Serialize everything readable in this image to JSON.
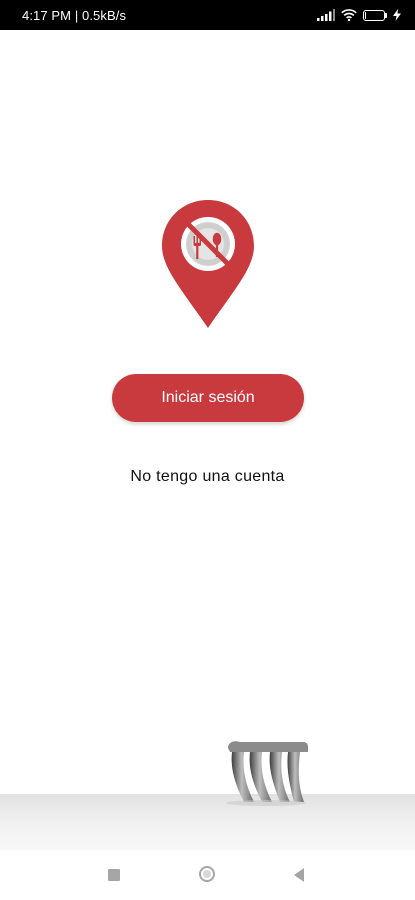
{
  "status_bar": {
    "time_speed": "4:17 PM | 0.5kB/s",
    "battery_level": "7",
    "icons": [
      "signal-icon",
      "wifi-icon",
      "battery-icon",
      "charging-icon"
    ],
    "battery_fraction": 0.07
  },
  "logo": {
    "icon": "map-pin-utensils-icon",
    "color": "#c93a3e"
  },
  "actions": {
    "login_label": "Iniciar sesión",
    "no_account_label": "No tengo una cuenta"
  },
  "colors": {
    "accent": "#c93a3e",
    "background": "#ffffff"
  },
  "nav_bar": {
    "icons": [
      "recent-apps-icon",
      "home-icon",
      "back-icon"
    ]
  }
}
